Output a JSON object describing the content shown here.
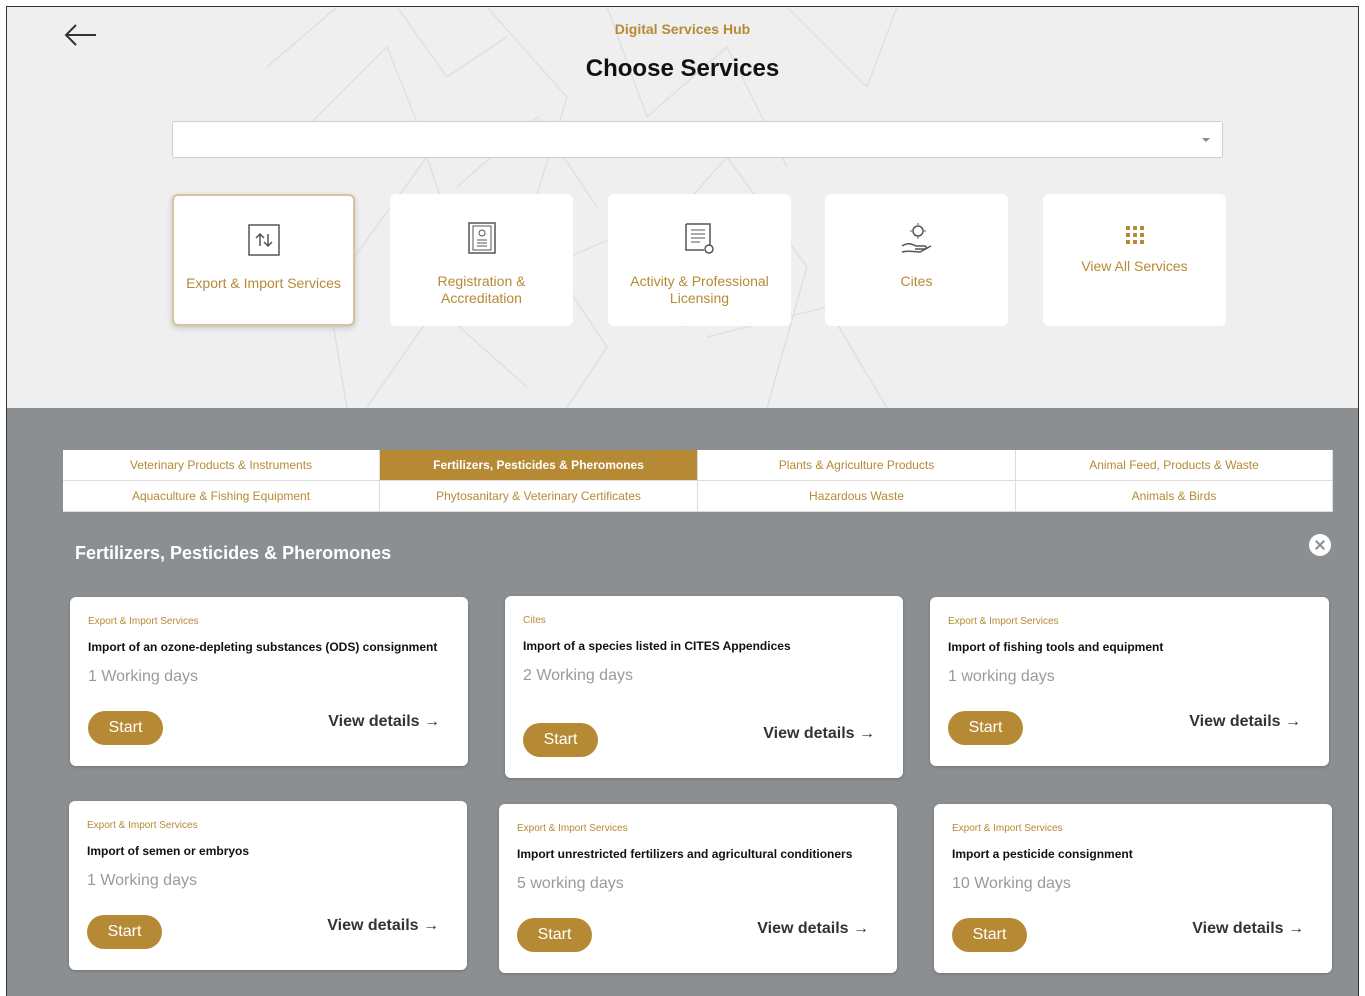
{
  "header": {
    "hub_title": "Digital Services Hub",
    "page_title": "Choose Services"
  },
  "search": {
    "value": ""
  },
  "categories": [
    {
      "label": "Export & Import Services",
      "icon": "export-import-icon",
      "active": true
    },
    {
      "label": "Registration & Accreditation",
      "icon": "registration-icon",
      "active": false
    },
    {
      "label": "Activity & Professional Licensing",
      "icon": "licensing-icon",
      "active": false
    },
    {
      "label": "Cites",
      "icon": "cites-icon",
      "active": false
    },
    {
      "label": "View All Services",
      "icon": "grid-icon",
      "active": false
    }
  ],
  "tabs": [
    {
      "label": "Veterinary Products & Instruments",
      "active": false
    },
    {
      "label": "Fertilizers, Pesticides & Pheromones",
      "active": true
    },
    {
      "label": "Plants & Agriculture Products",
      "active": false
    },
    {
      "label": "Animal Feed, Products & Waste",
      "active": false
    },
    {
      "label": "Aquaculture & Fishing Equipment",
      "active": false
    },
    {
      "label": "Phytosanitary & Veterinary Certificates",
      "active": false
    },
    {
      "label": "Hazardous Waste",
      "active": false
    },
    {
      "label": "Animals & Birds",
      "active": false
    }
  ],
  "section": {
    "title": "Fertilizers, Pesticides & Pheromones"
  },
  "accent_color": "#b68a35",
  "cards": [
    {
      "category": "Export & Import Services",
      "title": "Import of an ozone-depleting substances (ODS) consignment",
      "days": "1 Working days",
      "start": "Start",
      "details": "View details →"
    },
    {
      "category": "Cites",
      "title": "Import of a species listed in CITES Appendices",
      "days": "2 Working days",
      "start": "Start",
      "details": "View details →"
    },
    {
      "category": "Export & Import Services",
      "title": "Import of fishing tools and equipment",
      "days": "1 working days",
      "start": "Start",
      "details": "View details →"
    },
    {
      "category": "Export & Import Services",
      "title": "Import of semen or embryos",
      "days": "1 Working days",
      "start": "Start",
      "details": "View details →"
    },
    {
      "category": "Export & Import Services",
      "title": "Import unrestricted fertilizers and agricultural conditioners",
      "days": "5 working days",
      "start": "Start",
      "details": "View details →"
    },
    {
      "category": "Export & Import Services",
      "title": "Import a pesticide consignment",
      "days": "10 Working days",
      "start": "Start",
      "details": "View details →"
    }
  ]
}
